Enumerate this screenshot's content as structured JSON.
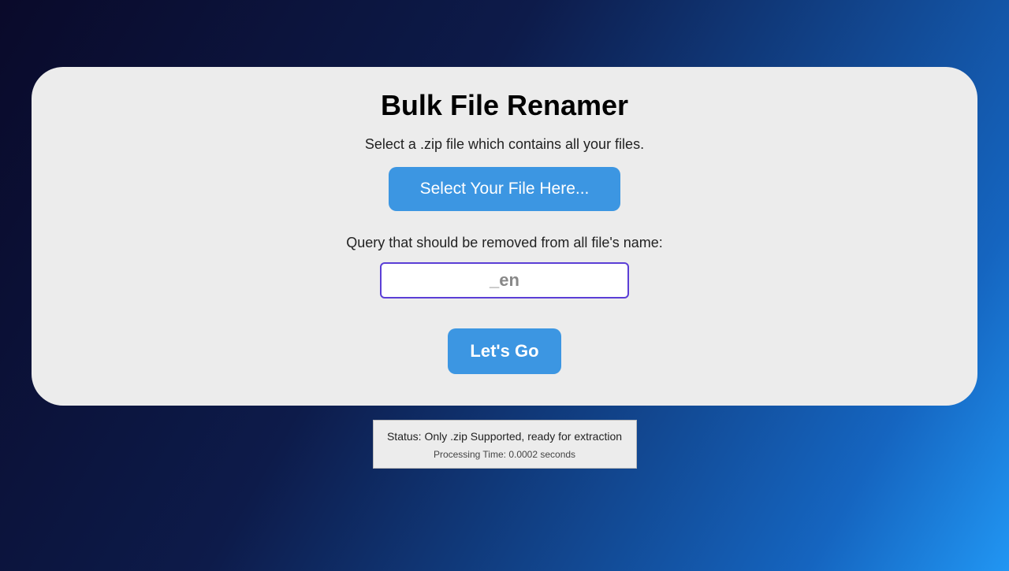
{
  "card": {
    "title": "Bulk File Renamer",
    "subtitle": "Select a .zip file which contains all your files.",
    "fileButton": "Select Your File Here...",
    "queryLabel": "Query that should be removed from all file's name:",
    "queryPlaceholder": "_en",
    "goButton": "Let's Go"
  },
  "status": {
    "statusLabel": "Status",
    "statusValue": "Only .zip Supported, ready for extraction",
    "timingLabel": "Processing Time",
    "timingValue": "0.0002 seconds"
  }
}
